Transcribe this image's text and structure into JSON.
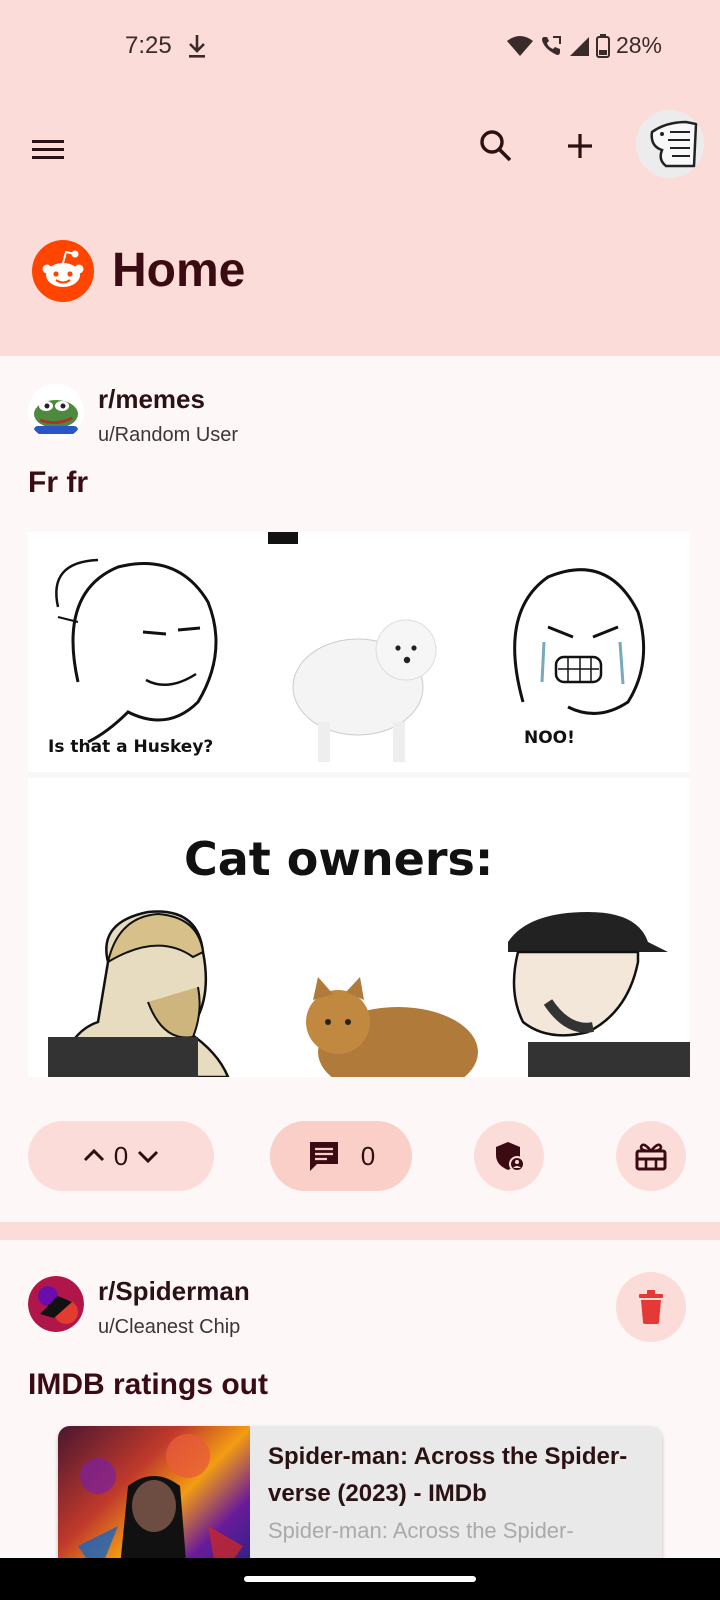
{
  "status": {
    "time": "7:25",
    "battery": "28%"
  },
  "header": {
    "title": "Home"
  },
  "posts": [
    {
      "subreddit": "r/memes",
      "user": "u/Random User",
      "title": "Fr fr",
      "image": {
        "caption_left": "Is that a Huskey?",
        "caption_right": "NOO!",
        "caption_center": "Cat owners:"
      },
      "votes": "0",
      "comments": "0"
    },
    {
      "subreddit": "r/Spiderman",
      "user": "u/Cleanest Chip",
      "title": "IMDB ratings out",
      "link": {
        "title": "Spider-man: Across the Spider-verse (2023) - IMDb",
        "description": "Spider-man: Across the Spider-"
      }
    }
  ],
  "colors": {
    "header_bg": "#fbdcd8",
    "accent": "#3b0b13",
    "reddit": "#ff4500",
    "delete": "#e53935"
  }
}
